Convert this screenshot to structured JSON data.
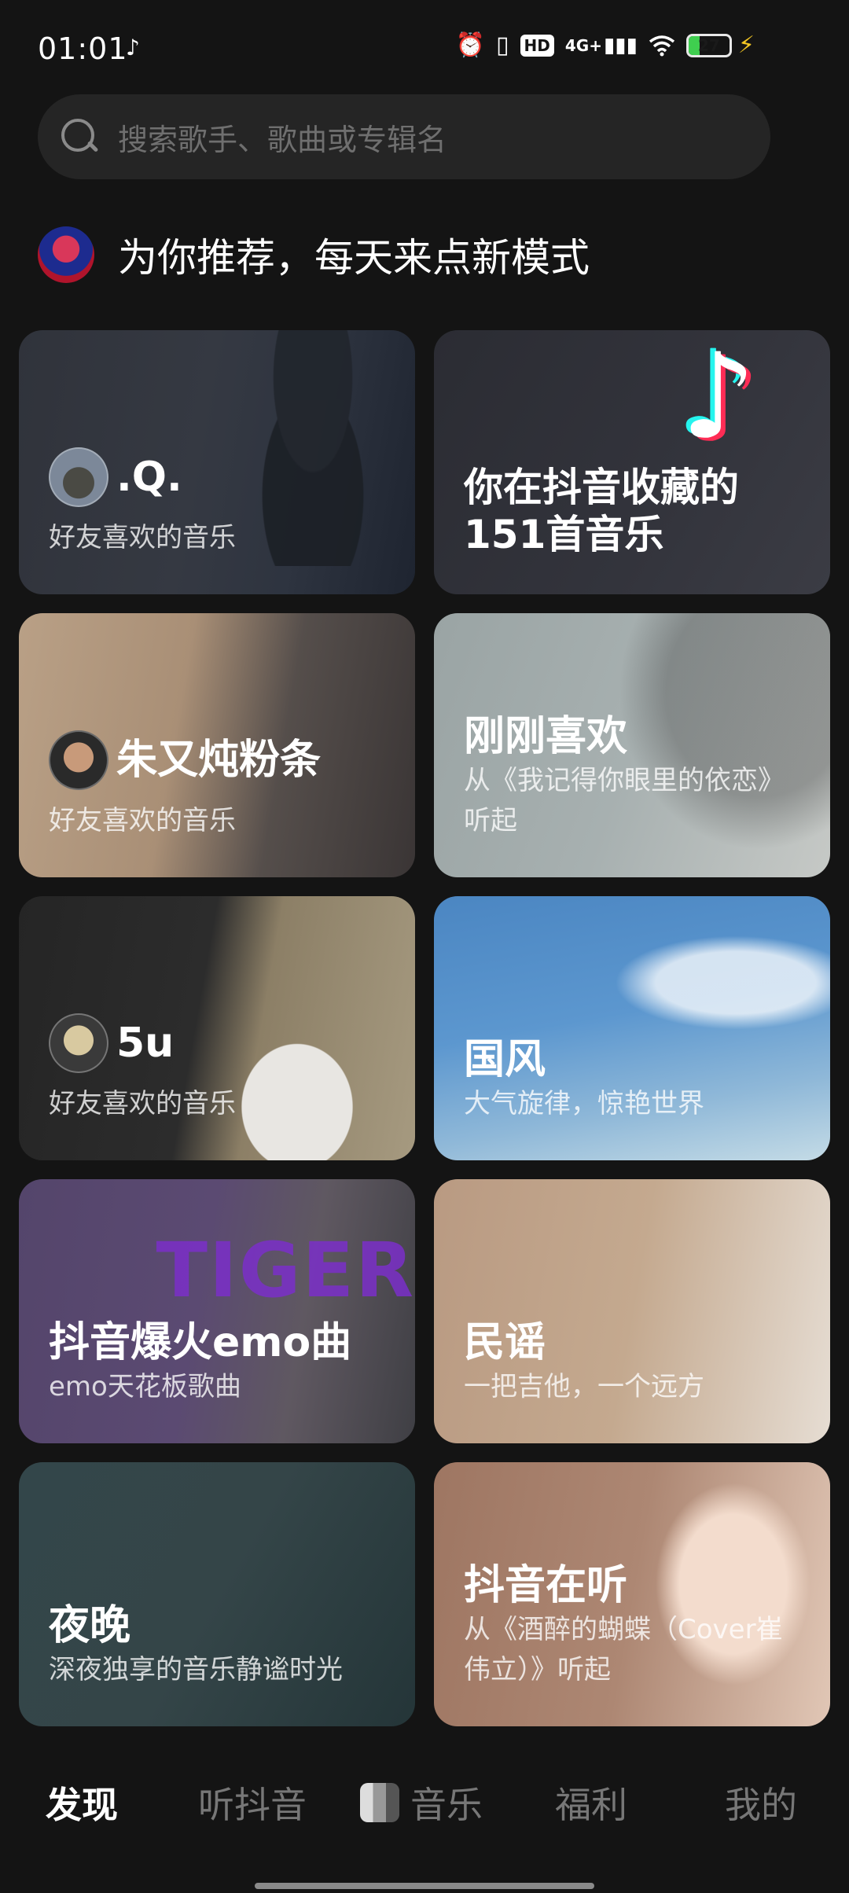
{
  "status_bar": {
    "time": "01:01",
    "note_icon": "music-note-icon",
    "icons": [
      "alarm-icon",
      "vibrate-icon",
      "hd-icon",
      "signal-4g-icon",
      "wifi-icon",
      "battery-icon",
      "charging-icon"
    ],
    "hd_label": "HD",
    "network_label": "4G+",
    "battery_level": "27",
    "battery_fill_fraction": 0.27,
    "battery_color": "#3fce4f"
  },
  "search": {
    "placeholder": "搜索歌手、歌曲或专辑名"
  },
  "recommend": {
    "title": "为你推荐，每天来点新模式"
  },
  "cards": [
    {
      "title": ".Q.",
      "subtitle": "好友喜欢的音乐",
      "has_avatar": true
    },
    {
      "title": "你在抖音收藏的151首音乐",
      "subtitle": ""
    },
    {
      "title": "朱又炖粉条",
      "subtitle": "好友喜欢的音乐",
      "has_avatar": true
    },
    {
      "title": "刚刚喜欢",
      "subtitle": "从《我记得你眼里的依恋》听起"
    },
    {
      "title": "5u",
      "subtitle": "好友喜欢的音乐",
      "has_avatar": true
    },
    {
      "title": "国风",
      "subtitle": "大气旋律，惊艳世界"
    },
    {
      "title": "抖音爆火emo曲",
      "subtitle": "emo天花板歌曲"
    },
    {
      "title": "民谣",
      "subtitle": "一把吉他，一个远方"
    },
    {
      "title": "夜晚",
      "subtitle": "深夜独享的音乐静谧时光"
    },
    {
      "title": "抖音在听",
      "subtitle": "从《酒醉的蝴蝶（Cover崔伟立）》听起"
    }
  ],
  "card_art": {
    "tiktok_note": "♪",
    "tiger": "TIGER"
  },
  "bottom_nav": {
    "items": [
      {
        "label": "发现",
        "active": true
      },
      {
        "label": "听抖音",
        "active": false
      },
      {
        "label": "音乐",
        "active": false
      },
      {
        "label": "福利",
        "active": false
      },
      {
        "label": "我的",
        "active": false
      }
    ]
  },
  "colors": {
    "background": "#141414",
    "search_bg": "#252525",
    "inactive_nav": "#777777",
    "active_nav": "#ffffff"
  }
}
